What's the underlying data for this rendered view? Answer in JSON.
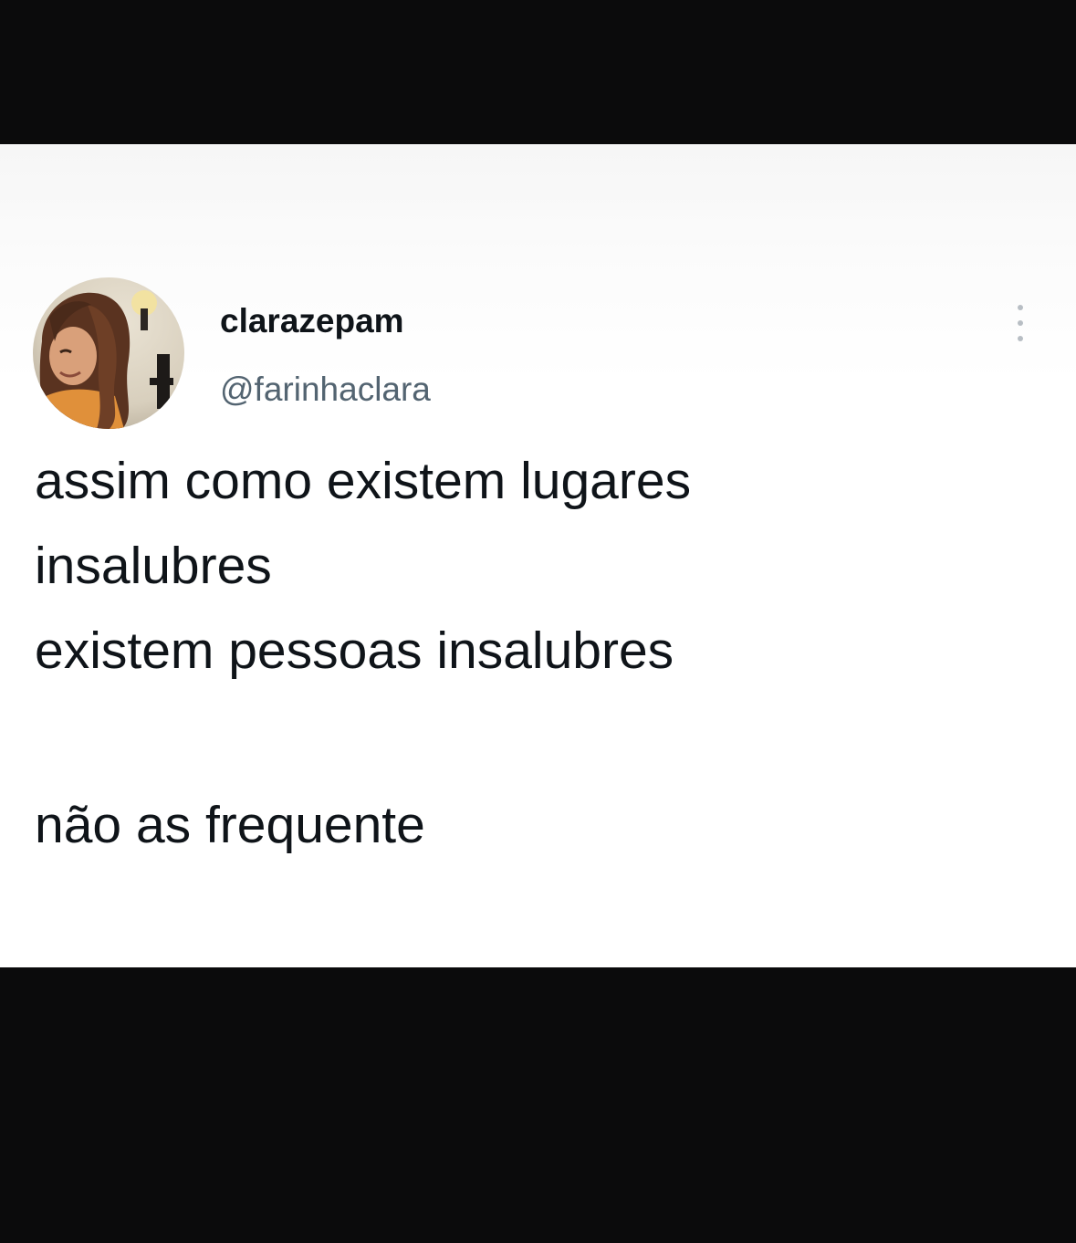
{
  "tweet": {
    "author": {
      "display_name": "clarazepam",
      "handle": "@farinhaclara",
      "avatar_icon": "profile-photo"
    },
    "more_icon": "more-vertical-icon",
    "text_lines": [
      "assim como existem lugares",
      "insalubres",
      "existem pessoas insalubres",
      "não as frequente"
    ]
  },
  "colors": {
    "frame_background": "#0b0b0c",
    "card_background": "#ffffff",
    "text_primary": "#0f1419",
    "text_secondary": "#536471"
  }
}
